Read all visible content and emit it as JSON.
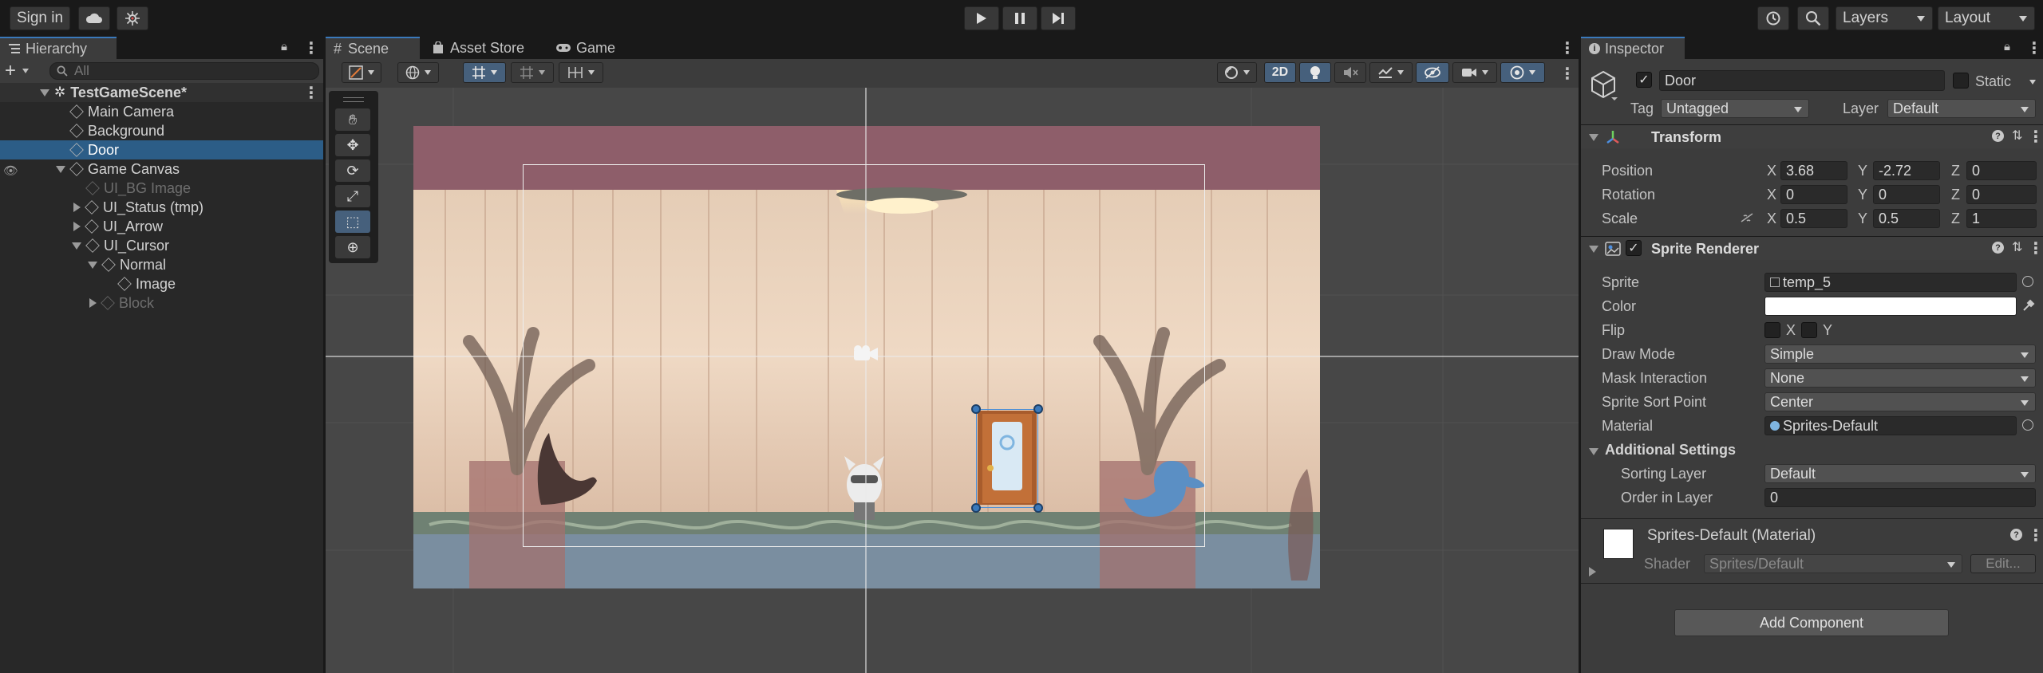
{
  "toolbar": {
    "sign_in": "Sign in",
    "layers": "Layers",
    "layout": "Layout"
  },
  "hierarchy": {
    "tab": "Hierarchy",
    "search_placeholder": "All",
    "items": [
      {
        "label": "TestGameScene*",
        "level": 0,
        "state": "expanded",
        "kind": "scene"
      },
      {
        "label": "Main Camera",
        "level": 1,
        "state": "none",
        "kind": "object"
      },
      {
        "label": "Background",
        "level": 1,
        "state": "none",
        "kind": "object"
      },
      {
        "label": "Door",
        "level": 1,
        "state": "none",
        "kind": "object",
        "selected": true
      },
      {
        "label": "Game Canvas",
        "level": 1,
        "state": "expanded",
        "kind": "object"
      },
      {
        "label": "UI_BG Image",
        "level": 2,
        "state": "none",
        "kind": "object",
        "disabled": true
      },
      {
        "label": "UI_Status (tmp)",
        "level": 2,
        "state": "collapsed",
        "kind": "object"
      },
      {
        "label": "UI_Arrow",
        "level": 2,
        "state": "collapsed",
        "kind": "object"
      },
      {
        "label": "UI_Cursor",
        "level": 2,
        "state": "expanded",
        "kind": "object"
      },
      {
        "label": "Normal",
        "level": 3,
        "state": "expanded",
        "kind": "object"
      },
      {
        "label": "Image",
        "level": 4,
        "state": "none",
        "kind": "object"
      },
      {
        "label": "Block",
        "level": 3,
        "state": "collapsed",
        "kind": "object",
        "disabled": true
      }
    ]
  },
  "scene_tabs": [
    "Scene",
    "Asset Store",
    "Game"
  ],
  "scene_toolbar": {
    "mode_2d": "2D"
  },
  "inspector": {
    "tab": "Inspector",
    "object_name": "Door",
    "static_label": "Static",
    "tag_label": "Tag",
    "tag_value": "Untagged",
    "layer_label": "Layer",
    "layer_value": "Default",
    "transform": {
      "title": "Transform",
      "position": {
        "label": "Position",
        "x": "3.68",
        "y": "-2.72",
        "z": "0"
      },
      "rotation": {
        "label": "Rotation",
        "x": "0",
        "y": "0",
        "z": "0"
      },
      "scale": {
        "label": "Scale",
        "x": "0.5",
        "y": "0.5",
        "z": "1"
      }
    },
    "sprite_renderer": {
      "title": "Sprite Renderer",
      "sprite_label": "Sprite",
      "sprite_value": "temp_5",
      "color_label": "Color",
      "color_value": "#ffffff",
      "flip_label": "Flip",
      "flip_x": "X",
      "flip_y": "Y",
      "draw_mode_label": "Draw Mode",
      "draw_mode_value": "Simple",
      "mask_label": "Mask Interaction",
      "mask_value": "None",
      "sort_point_label": "Sprite Sort Point",
      "sort_point_value": "Center",
      "material_label": "Material",
      "material_value": "Sprites-Default",
      "additional": "Additional Settings",
      "sorting_layer_label": "Sorting Layer",
      "sorting_layer_value": "Default",
      "order_label": "Order in Layer",
      "order_value": "0"
    },
    "material": {
      "title": "Sprites-Default (Material)",
      "shader_label": "Shader",
      "shader_value": "Sprites/Default",
      "edit": "Edit..."
    },
    "add_component": "Add Component"
  },
  "colors": {
    "selection": "#2c5d87",
    "accent": "#3a79bb"
  }
}
